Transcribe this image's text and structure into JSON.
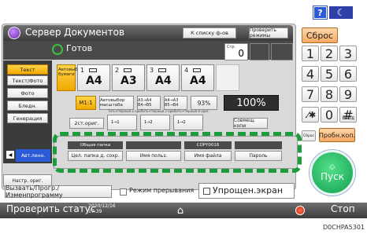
{
  "topbar": {
    "help": "?",
    "energy": "☾"
  },
  "header": {
    "title": "Сервер Документов",
    "to_list": "К списку ф-ов",
    "check_modes": "Проверить режимы"
  },
  "status": {
    "ready": "Готов",
    "count_label": "Стр.",
    "count": "0"
  },
  "left_tabs": [
    "Текст",
    "Текст/Фото",
    "Фото",
    "Бледн.",
    "Генерация"
  ],
  "paper": {
    "auto": "Автовыбор бумаги",
    "trays": [
      {
        "num": "1",
        "size": "A4"
      },
      {
        "num": "2",
        "size": "A3"
      },
      {
        "num": "3",
        "size": "A4"
      },
      {
        "num": "4",
        "size": "A4"
      }
    ]
  },
  "zoom": {
    "one_to_one": "M1:1",
    "auto": "Автовыбор масштаба",
    "preset_a": "A3→A4 B4→B5",
    "preset_b": "A4→A3 B5→B4",
    "pct_small": "93%",
    "pct_main": "100%"
  },
  "duplex": {
    "label": "2ст.ориг.",
    "hints": [
      "Тоть+Черный 2 ориг.",
      "Тоть+Черный 2 ориг.",
      "Тоть+Черный 8 ориг."
    ],
    "buttons": [
      "1→1",
      "1→2",
      "1→2"
    ],
    "combine": "Совмещ. копи"
  },
  "original": {
    "tab": "Авт.ленн.",
    "mode_tab": "Настр. ориг."
  },
  "modal": {
    "headers": [
      "Общая папка",
      "",
      "COPY0016",
      ""
    ],
    "buttons": [
      "Цел. папка д. сохр.",
      "Имя польз.",
      "Имя файла",
      "Пароль"
    ]
  },
  "bottom_panel": {
    "program": "Вызвать/Прогр./Изменпрограмму",
    "interrupt": "Режим прерывания",
    "simple": "Упрощен.экран"
  },
  "keypad": {
    "reset": "Сброс",
    "keys": [
      "1",
      "2",
      "3",
      "4",
      "5",
      "6",
      "7",
      "8",
      "9",
      ".⁄✱",
      "0",
      "#"
    ],
    "enter_sub": "Ввод",
    "cancel": "Сброс",
    "combine": "Пробн.коп.",
    "start": "Пуск"
  },
  "statusbar": {
    "check": "Проверить статус",
    "date": "2020/12/16",
    "time": "17:39",
    "stop": "Стоп"
  },
  "figure_code": "D0CHPA5301",
  "colors": {
    "accent": "#f2a900",
    "start": "#0f9f52",
    "highlight": "#1c9d3b"
  }
}
